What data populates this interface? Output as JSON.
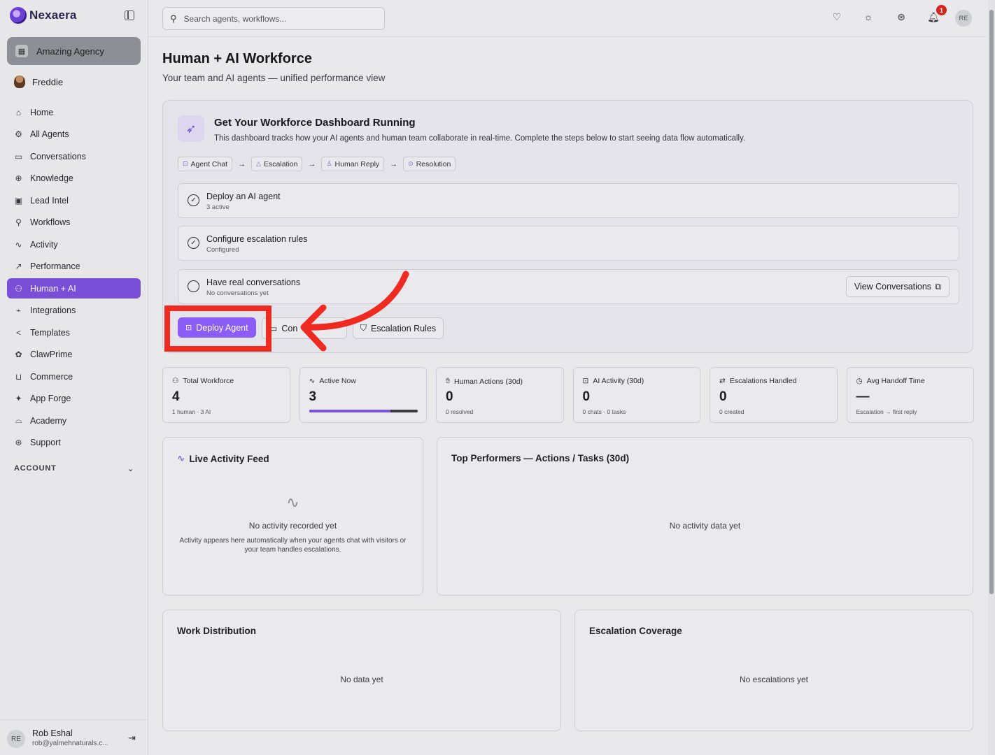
{
  "app": {
    "name": "Nexaera"
  },
  "sidebar": {
    "workspace": "Amazing Agency",
    "user": "Freddie",
    "items": [
      {
        "label": "Home",
        "icon": "⌂"
      },
      {
        "label": "All Agents",
        "icon": "⚙"
      },
      {
        "label": "Conversations",
        "icon": "▭"
      },
      {
        "label": "Knowledge",
        "icon": "⊕"
      },
      {
        "label": "Lead Intel",
        "icon": "▣"
      },
      {
        "label": "Workflows",
        "icon": "⚲"
      },
      {
        "label": "Activity",
        "icon": "∿"
      },
      {
        "label": "Performance",
        "icon": "↗"
      },
      {
        "label": "Human + AI",
        "icon": "⚇"
      },
      {
        "label": "Integrations",
        "icon": "⌁"
      },
      {
        "label": "Templates",
        "icon": "<"
      },
      {
        "label": "ClawPrime",
        "icon": "✿"
      },
      {
        "label": "Commerce",
        "icon": "⊔"
      },
      {
        "label": "App Forge",
        "icon": "✦"
      },
      {
        "label": "Academy",
        "icon": "⌓"
      },
      {
        "label": "Support",
        "icon": "⊛"
      }
    ],
    "account_label": "ACCOUNT",
    "footer": {
      "initials": "RE",
      "name": "Rob Eshal",
      "email": "rob@yalmehnaturals.c..."
    }
  },
  "topbar": {
    "search_placeholder": "Search agents, workflows...",
    "notification_count": "1",
    "avatar_initials": "RE"
  },
  "page": {
    "title": "Human + AI Workforce",
    "subtitle": "Your team and AI agents — unified performance view"
  },
  "setup": {
    "title": "Get Your Workforce Dashboard Running",
    "description": "This dashboard tracks how your AI agents and human team collaborate in real-time. Complete the steps below to start seeing data flow automatically.",
    "flow": [
      "Agent Chat",
      "Escalation",
      "Human Reply",
      "Resolution"
    ],
    "steps": [
      {
        "title": "Deploy an AI agent",
        "sub": "3 active",
        "done": true
      },
      {
        "title": "Configure escalation rules",
        "sub": "Configured",
        "done": true
      },
      {
        "title": "Have real conversations",
        "sub": "No conversations yet",
        "done": false
      }
    ],
    "view_conversations": "View Conversations",
    "deploy_agent": "Deploy Agent",
    "conversations_btn": "Con",
    "escalation_rules": "Escalation Rules"
  },
  "stats": [
    {
      "label": "Total Workforce",
      "value": "4",
      "note": "1 human · 3 AI"
    },
    {
      "label": "Active Now",
      "value": "3",
      "progress": 0.75
    },
    {
      "label": "Human Actions (30d)",
      "value": "0",
      "note": "0 resolved"
    },
    {
      "label": "AI Activity (30d)",
      "value": "0",
      "note": "0 chats · 0 tasks"
    },
    {
      "label": "Escalations Handled",
      "value": "0",
      "note": "0 created"
    },
    {
      "label": "Avg Handoff Time",
      "value": "—",
      "note": "Escalation → first reply"
    }
  ],
  "panels": {
    "live_feed": {
      "title": "Live Activity Feed",
      "empty": "No activity recorded yet",
      "empty_sub": "Activity appears here automatically when your agents chat with visitors or your team handles escalations."
    },
    "top_performers": {
      "title": "Top Performers — Actions / Tasks (30d)",
      "empty": "No activity data yet"
    },
    "work_distribution": {
      "title": "Work Distribution",
      "empty": "No data yet"
    },
    "escalation_coverage": {
      "title": "Escalation Coverage",
      "empty": "No escalations yet"
    }
  },
  "colors": {
    "accent": "#7a4fd8",
    "primary_button": "#8b5cf6",
    "highlight": "#ef2a20",
    "badge": "#d4231b"
  }
}
